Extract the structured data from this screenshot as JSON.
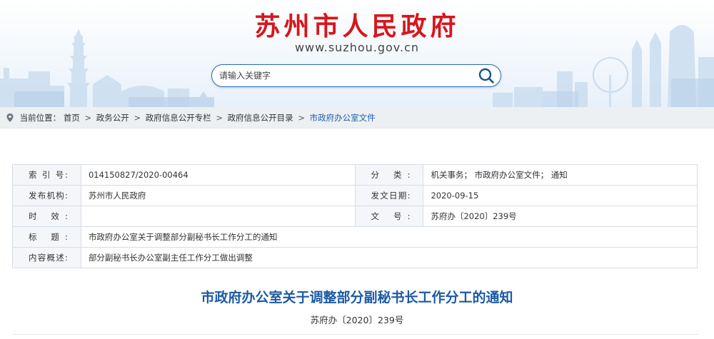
{
  "header": {
    "site_title": "苏州市人民政府",
    "site_url": "www.suzhou.gov.cn",
    "search_placeholder": "请输入关键字",
    "search_icon": "search-icon"
  },
  "breadcrumb": {
    "prefix": "当前位置：",
    "items": [
      "首页",
      "政务公开",
      "政府信息公开专栏",
      "政府信息公开目录",
      "市政府办公室文件"
    ],
    "separator": ">"
  },
  "info": {
    "index_label": "索 引 号:",
    "index_value": "014150827/2020-00464",
    "category_label": "分 类:",
    "category_value": "机关事务； 市政府办公室文件； 通知",
    "issuer_label": "发布机构:",
    "issuer_value": "苏州市人民政府",
    "date_label": "发文日期:",
    "date_value": "2020-09-15",
    "validity_label": "时 效:",
    "validity_value": "",
    "docno_label": "文 号:",
    "docno_value": "苏府办〔2020〕239号",
    "title_label": "标 题:",
    "title_value": "市政府办公室关于调整部分副秘书长工作分工的通知",
    "summary_label": "内容概述:",
    "summary_value": "部分副秘书长办公室副主任工作分工做出调整"
  },
  "document": {
    "title": "市政府办公室关于调整部分副秘书长工作分工的通知",
    "number": "苏府办〔2020〕239号"
  },
  "colors": {
    "brand_red": "#d7161d",
    "link_blue": "#1d5fad",
    "title_blue": "#1b5aa5"
  }
}
